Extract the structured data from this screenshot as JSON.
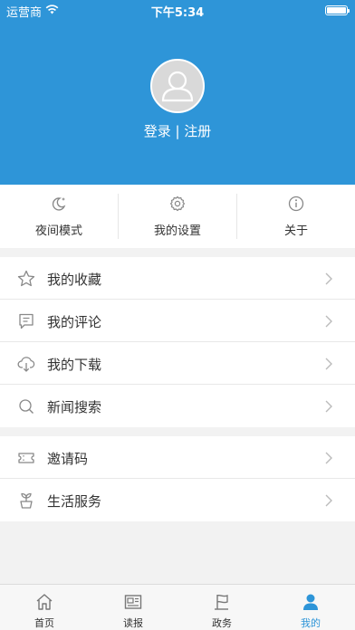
{
  "status_bar": {
    "carrier": "运营商",
    "time": "下午5:34"
  },
  "profile": {
    "login_text": "登录 | 注册"
  },
  "quick_actions": [
    {
      "label": "夜间模式",
      "icon": "moon-icon"
    },
    {
      "label": "我的设置",
      "icon": "gear-icon"
    },
    {
      "label": "关于",
      "icon": "info-icon"
    }
  ],
  "menu_group1": [
    {
      "label": "我的收藏",
      "icon": "star-icon"
    },
    {
      "label": "我的评论",
      "icon": "comment-icon"
    },
    {
      "label": "我的下载",
      "icon": "cloud-download-icon"
    },
    {
      "label": "新闻搜索",
      "icon": "search-icon"
    }
  ],
  "menu_group2": [
    {
      "label": "邀请码",
      "icon": "ticket-icon"
    },
    {
      "label": "生活服务",
      "icon": "plant-icon"
    }
  ],
  "tab_bar": [
    {
      "label": "首页",
      "icon": "home-icon"
    },
    {
      "label": "读报",
      "icon": "newspaper-icon"
    },
    {
      "label": "政务",
      "icon": "flag-icon"
    },
    {
      "label": "我的",
      "icon": "user-icon",
      "active": true
    }
  ],
  "colors": {
    "accent": "#2e95d8",
    "background": "#f2f2f2",
    "text": "#333333",
    "icon_gray": "#888888"
  }
}
